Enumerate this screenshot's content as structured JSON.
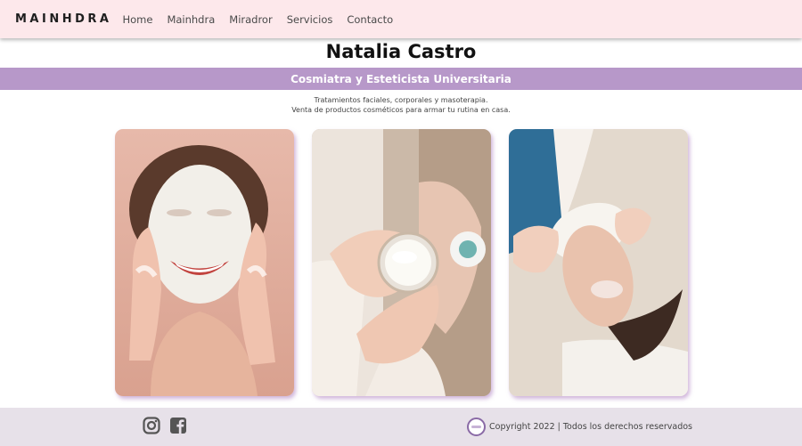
{
  "nav": {
    "brand": "MAINHDRA",
    "links": [
      "Home",
      "Mainhdra",
      "Miradror",
      "Servicios",
      "Contacto"
    ]
  },
  "hero": {
    "name": "Natalia Castro",
    "subtitle": "Cosmiatra y Esteticista Universitaria",
    "description": [
      "Tratamientos faciales, corporales y masoterapia.",
      "Venta de productos cosméticos para armar tu rutina en casa."
    ]
  },
  "gallery": [
    {
      "icon": "face-mask-photo"
    },
    {
      "icon": "cream-jar-photo"
    },
    {
      "icon": "facial-treatment-photo"
    }
  ],
  "footer": {
    "social_icons": [
      "instagram-icon",
      "facebook-icon"
    ],
    "copyright": "Copyright 2022 | Todos los derechos reservados"
  },
  "colors": {
    "nav_bg": "#fde8eb",
    "band_bg": "#b798c9",
    "footer_bg": "#e7e1e9"
  }
}
